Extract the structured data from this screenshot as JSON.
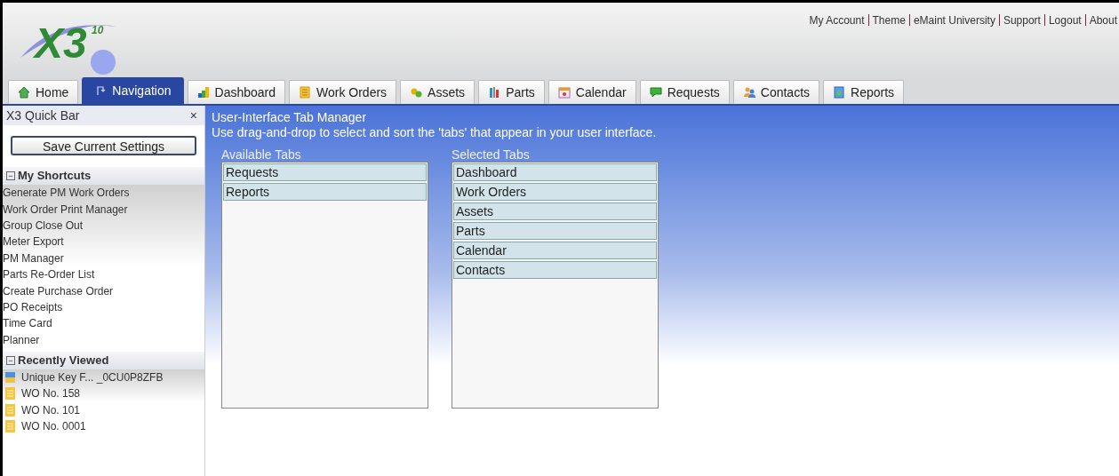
{
  "header": {
    "logo": {
      "text": "X3",
      "superscript": "10"
    },
    "links": [
      "My Account",
      "Theme",
      "eMaint University",
      "Support",
      "Logout",
      "About"
    ]
  },
  "tabs": [
    {
      "label": "Home",
      "kind": "home",
      "selected": false
    },
    {
      "label": "Navigation",
      "kind": "navigation",
      "selected": true
    },
    {
      "label": "Dashboard",
      "kind": "dashboard",
      "selected": false
    },
    {
      "label": "Work Orders",
      "kind": "workorders",
      "selected": false
    },
    {
      "label": "Assets",
      "kind": "assets",
      "selected": false
    },
    {
      "label": "Parts",
      "kind": "parts",
      "selected": false
    },
    {
      "label": "Calendar",
      "kind": "calendar",
      "selected": false
    },
    {
      "label": "Requests",
      "kind": "requests",
      "selected": false
    },
    {
      "label": "Contacts",
      "kind": "contacts",
      "selected": false
    },
    {
      "label": "Reports",
      "kind": "reports",
      "selected": false
    }
  ],
  "sidebar": {
    "title": "X3 Quick Bar",
    "close": "×",
    "save_button": "Save Current Settings",
    "sections": [
      {
        "title": "My Shortcuts",
        "toggle": "−",
        "expanded": true,
        "items": [
          {
            "label": "Generate PM Work Orders"
          },
          {
            "label": "Work Order Print Manager"
          },
          {
            "label": "Group Close Out"
          },
          {
            "label": "Meter Export"
          },
          {
            "label": "PM Manager"
          },
          {
            "label": "Parts Re-Order List"
          },
          {
            "label": "Create Purchase Order"
          },
          {
            "label": "PO Receipts"
          },
          {
            "label": "Time Card"
          },
          {
            "label": "Planner"
          }
        ]
      },
      {
        "title": "Recently Viewed",
        "toggle": "−",
        "expanded": true,
        "items": [
          {
            "label": "Unique Key F... _0CU0P8ZFB",
            "kind": "record"
          },
          {
            "label": "WO No. 158",
            "kind": "workorder"
          },
          {
            "label": "WO No. 101",
            "kind": "workorder"
          },
          {
            "label": "WO No. 0001",
            "kind": "workorder"
          }
        ]
      }
    ]
  },
  "content": {
    "title": "User-Interface Tab Manager",
    "description": "Use drag-and-drop to select and sort the 'tabs' that appear in your user interface.",
    "lists": [
      {
        "heading": "Available Tabs",
        "items": [
          "Requests",
          "Reports"
        ]
      },
      {
        "heading": "Selected Tabs",
        "items": [
          "Dashboard",
          "Work Orders",
          "Assets",
          "Parts",
          "Calendar",
          "Contacts"
        ]
      }
    ]
  }
}
